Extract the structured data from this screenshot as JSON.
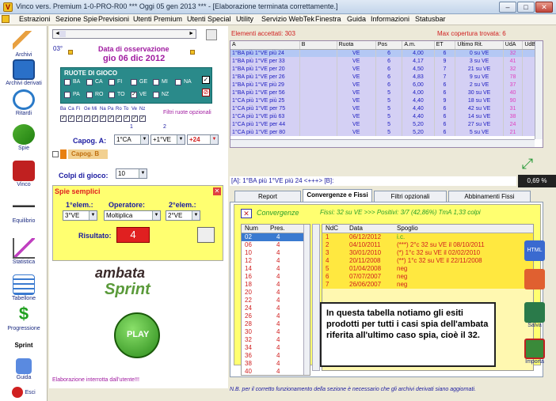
{
  "window": {
    "title": "Vinco vers. Premium  1-0-PRO-R00  ***  Oggi 05 gen 2013  ***  - [Elaborazione terminata correttamente.]"
  },
  "menu": [
    "Estrazioni",
    "Sezione Spie",
    "Previsioni",
    "Utenti Premium",
    "Utenti Special",
    "Utility",
    "Servizio WebTek",
    "Finestra",
    "Guida",
    "Informazioni",
    "Statusbar"
  ],
  "sidebar": [
    "Archivi",
    "Archivi derivati",
    "Ritardi",
    "Spie",
    "Vinco",
    "Equilibrio",
    "Statistica",
    "Tabellone",
    "Progressione",
    "Sprint",
    "Guida",
    "Esci"
  ],
  "left": {
    "degrees": "03°",
    "obs_label": "Data di osservazione",
    "obs_date": "gio 06 dic 2012",
    "ruote_title": "RUOTE DI GIOCO",
    "ruote": [
      "BA",
      "CA",
      "FI",
      "GE",
      "MI",
      "NA",
      "PA",
      "RO",
      "TO",
      "VE",
      "NZ"
    ],
    "filtri_abbr": [
      "Ba",
      "Ca",
      "Fi",
      "Ge",
      "Mi",
      "Na",
      "Pa",
      "Ro",
      "To",
      "Ve",
      "Nz"
    ],
    "filtri_label": "Filtri ruote opzionali",
    "num1": "1",
    "num2": "2",
    "capogA_label": "Capog. A:",
    "capogA_1": "1°CA",
    "capogA_2": "+1°VE",
    "capogA_3": "+24",
    "capogB_label": "Capog. B",
    "colpi_label": "Colpi di gioco:",
    "colpi_value": "10",
    "spie_title": "Spie semplici",
    "elem1_label": "1°elem.:",
    "elem1_value": "3°VE",
    "operatore_label": "Operatore:",
    "operatore_value": "Moltiplica",
    "elem2_label": "2°elem.:",
    "elem2_value": "2°VE",
    "risultato_label": "Risultato:",
    "risultato_value": "4",
    "logo_top": "ambata",
    "logo_bottom": "Sprint",
    "play_label": "PLAY",
    "status": "Elaborazione interrotta dall'utente!!!"
  },
  "grid": {
    "accepted": "Elementi accettati: 303",
    "maxcop": "Max copertura trovata:   6",
    "headers": [
      "A",
      "B",
      "Ruota",
      "Pos",
      "A.m.",
      "ET",
      "Ultimo Rit.",
      "UdA",
      "UdB"
    ],
    "rows": [
      [
        "1°BA più  1°VE  più 24",
        "",
        "VE",
        "6",
        "4,00",
        "6",
        "0 su VE",
        "32",
        ""
      ],
      [
        "1°BA più  1°VE  per 33",
        "",
        "VE",
        "6",
        "4,17",
        "9",
        "3 su VE",
        "41",
        ""
      ],
      [
        "1°BA più  1°VE  per 20",
        "",
        "VE",
        "6",
        "4,50",
        "7",
        "21 su VE",
        "32",
        ""
      ],
      [
        "1°BA più  1°VE  per 26",
        "",
        "VE",
        "6",
        "4,83",
        "7",
        "9 su VE",
        "78",
        ""
      ],
      [
        "1°BA più  1°VE  più 29",
        "",
        "VE",
        "6",
        "6,00",
        "6",
        "2 su VE",
        "37",
        ""
      ],
      [
        "1°BA più  1°VE  per 56",
        "",
        "VE",
        "5",
        "4,00",
        "6",
        "30 su VE",
        "40",
        ""
      ],
      [
        "1°CA più  1°VE  più 25",
        "",
        "VE",
        "5",
        "4,40",
        "9",
        "18 su VE",
        "90",
        ""
      ],
      [
        "1°CA più  1°VE  per 75",
        "",
        "VE",
        "5",
        "4,40",
        "6",
        "42 su VE",
        "31",
        ""
      ],
      [
        "1°CA più  1°VE  più 63",
        "",
        "VE",
        "5",
        "4,40",
        "6",
        "14 su VE",
        "38",
        ""
      ],
      [
        "1°CA più  1°VE  per 44",
        "",
        "VE",
        "5",
        "5,20",
        "6",
        "27 su VE",
        "24",
        ""
      ],
      [
        "1°CA più  1°VE  per 80",
        "",
        "VE",
        "5",
        "5,20",
        "6",
        "5 su VE",
        "21",
        ""
      ]
    ]
  },
  "formula": "[A]: 1°BA più  1°VE  più 24 <+++> [B]:",
  "percent": "0,69 %",
  "tabs": [
    "Report",
    "Convergenze e Fissi",
    "Filtri opzionali",
    "Abbinamenti Fissi"
  ],
  "conv": {
    "title": "Convergenze",
    "info": "Fissi: 32 su VE >>> Positivi: 3/7 (42,86%)  TmA 1,33 colpi",
    "num_headers": [
      "Num",
      "Pres."
    ],
    "nums": [
      [
        "02",
        "4"
      ],
      [
        "06",
        "4"
      ],
      [
        "10",
        "4"
      ],
      [
        "12",
        "4"
      ],
      [
        "14",
        "4"
      ],
      [
        "16",
        "4"
      ],
      [
        "18",
        "4"
      ],
      [
        "20",
        "4"
      ],
      [
        "22",
        "4"
      ],
      [
        "24",
        "4"
      ],
      [
        "26",
        "4"
      ],
      [
        "28",
        "4"
      ],
      [
        "30",
        "4"
      ],
      [
        "32",
        "4"
      ],
      [
        "34",
        "4"
      ],
      [
        "36",
        "4"
      ],
      [
        "38",
        "4"
      ],
      [
        "40",
        "4"
      ]
    ],
    "spo_headers": [
      "NdC",
      "Data",
      "Spoglio"
    ],
    "spoglio": [
      [
        "1",
        "06/12/2012",
        "i.c."
      ],
      [
        "2",
        "04/10/2011",
        "(***) 2°c 32 su VE il 08/10/2011"
      ],
      [
        "3",
        "30/01/2010",
        "(*) 1°c 32 su VE il 02/02/2010"
      ],
      [
        "4",
        "20/11/2008",
        "(**) 1°c 32 su VE il 22/11/2008"
      ],
      [
        "5",
        "01/04/2008",
        "neg"
      ],
      [
        "6",
        "07/07/2007",
        "neg"
      ],
      [
        "7",
        "26/06/2007",
        "neg"
      ]
    ]
  },
  "note": "In questa tabella notiamo gli esiti prodotti per tutti i casi spia dell'ambata riferita all'ultimo caso spia, cioè il 32.",
  "footer": "N.B. per il corretto funzionamento della sezione è necessario che gli archivi derivati siano aggiornati.",
  "right": {
    "salva": "Salva",
    "importa": "Importa",
    "html_icon": "HTML"
  }
}
